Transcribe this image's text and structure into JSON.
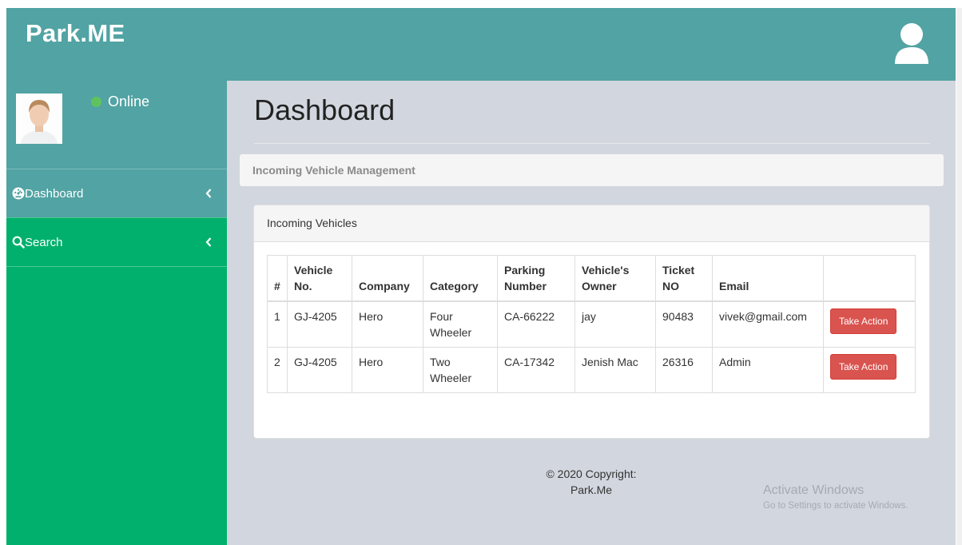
{
  "header": {
    "brand": "Park.ME",
    "user_icon": "user-icon"
  },
  "sidebar": {
    "status": "Online",
    "status_color": "#5ec35e",
    "items": [
      {
        "label": "Dashboard",
        "icon": "dashboard-icon"
      },
      {
        "label": "Search",
        "icon": "search-icon"
      }
    ]
  },
  "main": {
    "title": "Dashboard",
    "breadcrumb": "Incoming Vehicle Management",
    "panel_title": "Incoming Vehicles",
    "table": {
      "headers": [
        "#",
        "Vehicle No.",
        "Company",
        "Category",
        "Parking Number",
        "Vehicle's Owner",
        "Ticket NO",
        "Email",
        ""
      ],
      "rows": [
        {
          "num": "1",
          "vehicle": "GJ-4205",
          "company": "Hero",
          "category": "Four Wheeler",
          "parking": "CA-66222",
          "owner": "jay",
          "ticket": "90483",
          "email": "vivek@gmail.com",
          "action": "Take Action"
        },
        {
          "num": "2",
          "vehicle": "GJ-4205",
          "company": "Hero",
          "category": "Two Wheeler",
          "parking": "CA-17342",
          "owner": "Jenish Mac",
          "ticket": "26316",
          "email": "Admin",
          "action": "Take Action"
        }
      ]
    }
  },
  "footer": {
    "line1": "© 2020 Copyright:",
    "line2": "Park.Me"
  },
  "watermark": {
    "title": "Activate Windows",
    "subtitle": "Go to Settings to activate Windows."
  },
  "colors": {
    "header": "#52a3a3",
    "sidebar": "#00b06c",
    "danger": "#d9534f",
    "content_bg": "#d2d6de"
  }
}
